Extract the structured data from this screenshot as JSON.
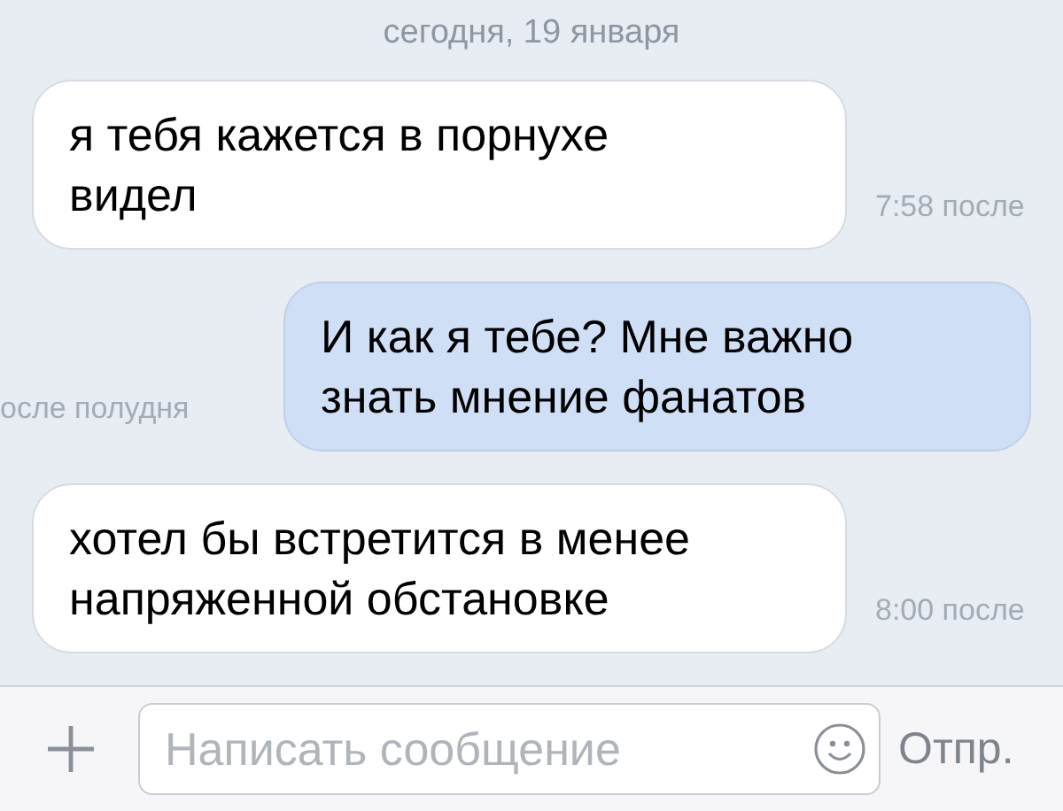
{
  "date_header": "сегодня, 19 января",
  "messages": [
    {
      "kind": "incoming",
      "text": "я тебя кажется в порнухе видел",
      "time": "7:58 после"
    },
    {
      "kind": "outgoing",
      "text": "И как я тебе? Мне важно знать мнение фанатов",
      "time": "осле полудня"
    },
    {
      "kind": "incoming",
      "text": "хотел бы встретится в менее напряженной обстановке",
      "time": "8:00 после"
    }
  ],
  "composer": {
    "placeholder": "Написать сообщение",
    "send_button": {
      "label": "Отпр.",
      "disabled": true
    }
  }
}
